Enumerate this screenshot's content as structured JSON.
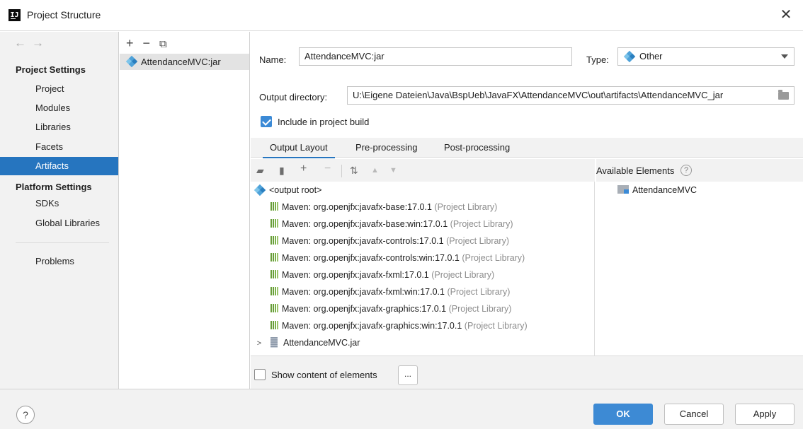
{
  "window": {
    "title": "Project Structure",
    "app_icon_letter": "IJ"
  },
  "sidebar": {
    "project_settings_header": "Project Settings",
    "project_items": [
      {
        "label": "Project",
        "selected": false
      },
      {
        "label": "Modules",
        "selected": false
      },
      {
        "label": "Libraries",
        "selected": false
      },
      {
        "label": "Facets",
        "selected": false
      },
      {
        "label": "Artifacts",
        "selected": true
      }
    ],
    "platform_settings_header": "Platform Settings",
    "platform_items": [
      {
        "label": "SDKs"
      },
      {
        "label": "Global Libraries"
      }
    ],
    "problems_label": "Problems"
  },
  "artifacts": {
    "items": [
      {
        "label": "AttendanceMVC:jar"
      }
    ]
  },
  "form": {
    "name_label": "Name:",
    "name_value": "AttendanceMVC:jar",
    "type_label": "Type:",
    "type_value": "Other",
    "output_dir_label": "Output directory:",
    "output_dir_value": "U:\\Eigene Dateien\\Java\\BspUeb\\JavaFX\\AttendanceMVC\\out\\artifacts\\AttendanceMVC_jar",
    "include_label": "Include in project build",
    "include_checked": true
  },
  "tabs": [
    {
      "label": "Output Layout",
      "active": true
    },
    {
      "label": "Pre-processing",
      "active": false
    },
    {
      "label": "Post-processing",
      "active": false
    }
  ],
  "layout_tree": {
    "root_label": "<output root>",
    "libraries": [
      {
        "name": "Maven: org.openjfx:javafx-base:17.0.1",
        "suffix": "(Project Library)"
      },
      {
        "name": "Maven: org.openjfx:javafx-base:win:17.0.1",
        "suffix": "(Project Library)"
      },
      {
        "name": "Maven: org.openjfx:javafx-controls:17.0.1",
        "suffix": "(Project Library)"
      },
      {
        "name": "Maven: org.openjfx:javafx-controls:win:17.0.1",
        "suffix": "(Project Library)"
      },
      {
        "name": "Maven: org.openjfx:javafx-fxml:17.0.1",
        "suffix": "(Project Library)"
      },
      {
        "name": "Maven: org.openjfx:javafx-fxml:win:17.0.1",
        "suffix": "(Project Library)"
      },
      {
        "name": "Maven: org.openjfx:javafx-graphics:17.0.1",
        "suffix": "(Project Library)"
      },
      {
        "name": "Maven: org.openjfx:javafx-graphics:win:17.0.1",
        "suffix": "(Project Library)"
      }
    ],
    "jar_label": "AttendanceMVC.jar"
  },
  "available": {
    "header": "Available Elements",
    "help_glyph": "?",
    "items": [
      {
        "label": "AttendanceMVC"
      }
    ]
  },
  "show_content": {
    "label": "Show content of elements",
    "checked": false,
    "button_label": "..."
  },
  "footer": {
    "help_glyph": "?",
    "ok_label": "OK",
    "cancel_label": "Cancel",
    "apply_label": "Apply"
  },
  "colors": {
    "accent": "#2675bf",
    "primary_button": "#3d8ad4",
    "panel_bg": "#f2f2f2"
  }
}
